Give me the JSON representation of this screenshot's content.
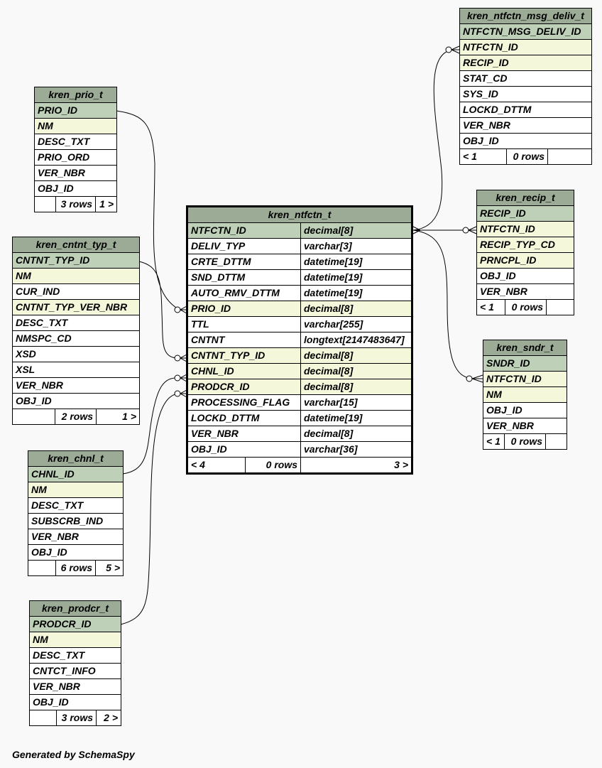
{
  "footer": "Generated by SchemaSpy",
  "tables": {
    "msg_deliv": {
      "name": "kren_ntfctn_msg_deliv_t",
      "columns": [
        {
          "name": "NTFCTN_MSG_DELIV_ID",
          "kind": "pk"
        },
        {
          "name": "NTFCTN_ID",
          "kind": "fk"
        },
        {
          "name": "RECIP_ID",
          "kind": "fk"
        },
        {
          "name": "STAT_CD",
          "kind": ""
        },
        {
          "name": "SYS_ID",
          "kind": ""
        },
        {
          "name": "LOCKD_DTTM",
          "kind": ""
        },
        {
          "name": "VER_NBR",
          "kind": ""
        },
        {
          "name": "OBJ_ID",
          "kind": ""
        }
      ],
      "footer": {
        "parents": "< 1",
        "rows": "0 rows",
        "children": ""
      }
    },
    "prio": {
      "name": "kren_prio_t",
      "columns": [
        {
          "name": "PRIO_ID",
          "kind": "pk"
        },
        {
          "name": "NM",
          "kind": "fk"
        },
        {
          "name": "DESC_TXT",
          "kind": ""
        },
        {
          "name": "PRIO_ORD",
          "kind": ""
        },
        {
          "name": "VER_NBR",
          "kind": ""
        },
        {
          "name": "OBJ_ID",
          "kind": ""
        }
      ],
      "footer": {
        "parents": "",
        "rows": "3 rows",
        "children": "1 >"
      }
    },
    "recip": {
      "name": "kren_recip_t",
      "columns": [
        {
          "name": "RECIP_ID",
          "kind": "pk"
        },
        {
          "name": "NTFCTN_ID",
          "kind": "fk"
        },
        {
          "name": "RECIP_TYP_CD",
          "kind": "fk"
        },
        {
          "name": "PRNCPL_ID",
          "kind": "fk"
        },
        {
          "name": "OBJ_ID",
          "kind": ""
        },
        {
          "name": "VER_NBR",
          "kind": ""
        }
      ],
      "footer": {
        "parents": "< 1",
        "rows": "0 rows",
        "children": ""
      }
    },
    "cntnt_typ": {
      "name": "kren_cntnt_typ_t",
      "columns": [
        {
          "name": "CNTNT_TYP_ID",
          "kind": "pk"
        },
        {
          "name": "NM",
          "kind": "fk"
        },
        {
          "name": "CUR_IND",
          "kind": ""
        },
        {
          "name": "CNTNT_TYP_VER_NBR",
          "kind": "fk"
        },
        {
          "name": "DESC_TXT",
          "kind": ""
        },
        {
          "name": "NMSPC_CD",
          "kind": ""
        },
        {
          "name": "XSD",
          "kind": ""
        },
        {
          "name": "XSL",
          "kind": ""
        },
        {
          "name": "VER_NBR",
          "kind": ""
        },
        {
          "name": "OBJ_ID",
          "kind": ""
        }
      ],
      "footer": {
        "parents": "",
        "rows": "2 rows",
        "children": "1 >"
      }
    },
    "ntfctn": {
      "name": "kren_ntfctn_t",
      "columns": [
        {
          "name": "NTFCTN_ID",
          "type": "decimal[8]",
          "kind": "pk"
        },
        {
          "name": "DELIV_TYP",
          "type": "varchar[3]",
          "kind": ""
        },
        {
          "name": "CRTE_DTTM",
          "type": "datetime[19]",
          "kind": ""
        },
        {
          "name": "SND_DTTM",
          "type": "datetime[19]",
          "kind": ""
        },
        {
          "name": "AUTO_RMV_DTTM",
          "type": "datetime[19]",
          "kind": ""
        },
        {
          "name": "PRIO_ID",
          "type": "decimal[8]",
          "kind": "fk"
        },
        {
          "name": "TTL",
          "type": "varchar[255]",
          "kind": ""
        },
        {
          "name": "CNTNT",
          "type": "longtext[2147483647]",
          "kind": ""
        },
        {
          "name": "CNTNT_TYP_ID",
          "type": "decimal[8]",
          "kind": "fk"
        },
        {
          "name": "CHNL_ID",
          "type": "decimal[8]",
          "kind": "fk"
        },
        {
          "name": "PRODCR_ID",
          "type": "decimal[8]",
          "kind": "fk"
        },
        {
          "name": "PROCESSING_FLAG",
          "type": "varchar[15]",
          "kind": ""
        },
        {
          "name": "LOCKD_DTTM",
          "type": "datetime[19]",
          "kind": ""
        },
        {
          "name": "VER_NBR",
          "type": "decimal[8]",
          "kind": ""
        },
        {
          "name": "OBJ_ID",
          "type": "varchar[36]",
          "kind": ""
        }
      ],
      "footer": {
        "parents": "< 4",
        "rows": "0 rows",
        "children": "3 >"
      }
    },
    "sndr": {
      "name": "kren_sndr_t",
      "columns": [
        {
          "name": "SNDR_ID",
          "kind": "pk"
        },
        {
          "name": "NTFCTN_ID",
          "kind": "fk"
        },
        {
          "name": "NM",
          "kind": "fk"
        },
        {
          "name": "OBJ_ID",
          "kind": ""
        },
        {
          "name": "VER_NBR",
          "kind": ""
        }
      ],
      "footer": {
        "parents": "< 1",
        "rows": "0 rows",
        "children": ""
      }
    },
    "chnl": {
      "name": "kren_chnl_t",
      "columns": [
        {
          "name": "CHNL_ID",
          "kind": "pk"
        },
        {
          "name": "NM",
          "kind": "fk"
        },
        {
          "name": "DESC_TXT",
          "kind": ""
        },
        {
          "name": "SUBSCRB_IND",
          "kind": ""
        },
        {
          "name": "VER_NBR",
          "kind": ""
        },
        {
          "name": "OBJ_ID",
          "kind": ""
        }
      ],
      "footer": {
        "parents": "",
        "rows": "6 rows",
        "children": "5 >"
      }
    },
    "prodcr": {
      "name": "kren_prodcr_t",
      "columns": [
        {
          "name": "PRODCR_ID",
          "kind": "pk"
        },
        {
          "name": "NM",
          "kind": "fk"
        },
        {
          "name": "DESC_TXT",
          "kind": ""
        },
        {
          "name": "CNTCT_INFO",
          "kind": ""
        },
        {
          "name": "VER_NBR",
          "kind": ""
        },
        {
          "name": "OBJ_ID",
          "kind": ""
        }
      ],
      "footer": {
        "parents": "",
        "rows": "3 rows",
        "children": "2 >"
      }
    }
  }
}
